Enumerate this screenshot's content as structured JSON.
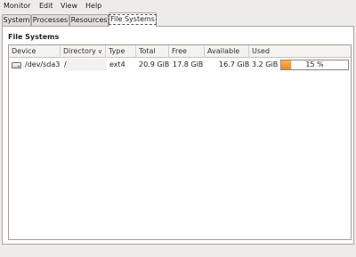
{
  "menubar": {
    "items": [
      "Monitor",
      "Edit",
      "View",
      "Help"
    ]
  },
  "tabs": [
    {
      "label": "System",
      "active": false
    },
    {
      "label": "Processes",
      "active": false
    },
    {
      "label": "Resources",
      "active": false
    },
    {
      "label": "File Systems",
      "active": true
    }
  ],
  "filesystems": {
    "section_title": "File Systems",
    "columns": [
      "Device",
      "Directory",
      "Type",
      "Total",
      "Free",
      "Available",
      "Used"
    ],
    "sorted_column": "Directory",
    "rows": [
      {
        "device": "/dev/sda3",
        "directory": "/",
        "type": "ext4",
        "total": "20.9 GiB",
        "free": "17.8 GiB",
        "available": "16.7 GiB",
        "used": "3.2 GiB",
        "used_percent": 15,
        "used_percent_label": "15 %"
      }
    ]
  },
  "colors": {
    "usage_fill": "#f08a1d",
    "selection_dash": "#555555"
  }
}
